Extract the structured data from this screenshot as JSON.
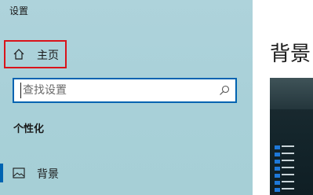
{
  "window": {
    "title": "设置"
  },
  "sidebar": {
    "home": {
      "label": "主页",
      "icon": "home-icon"
    },
    "search": {
      "placeholder": "查找设置",
      "value": "",
      "icon": "search-icon"
    },
    "section_title": "个性化",
    "items": [
      {
        "label": "背景",
        "icon": "picture-icon",
        "selected": true
      }
    ]
  },
  "main": {
    "page_title": "背景"
  },
  "colors": {
    "accent": "#0063b1",
    "highlight_border": "#d9141b",
    "sidebar_bg": "#aed3db"
  }
}
